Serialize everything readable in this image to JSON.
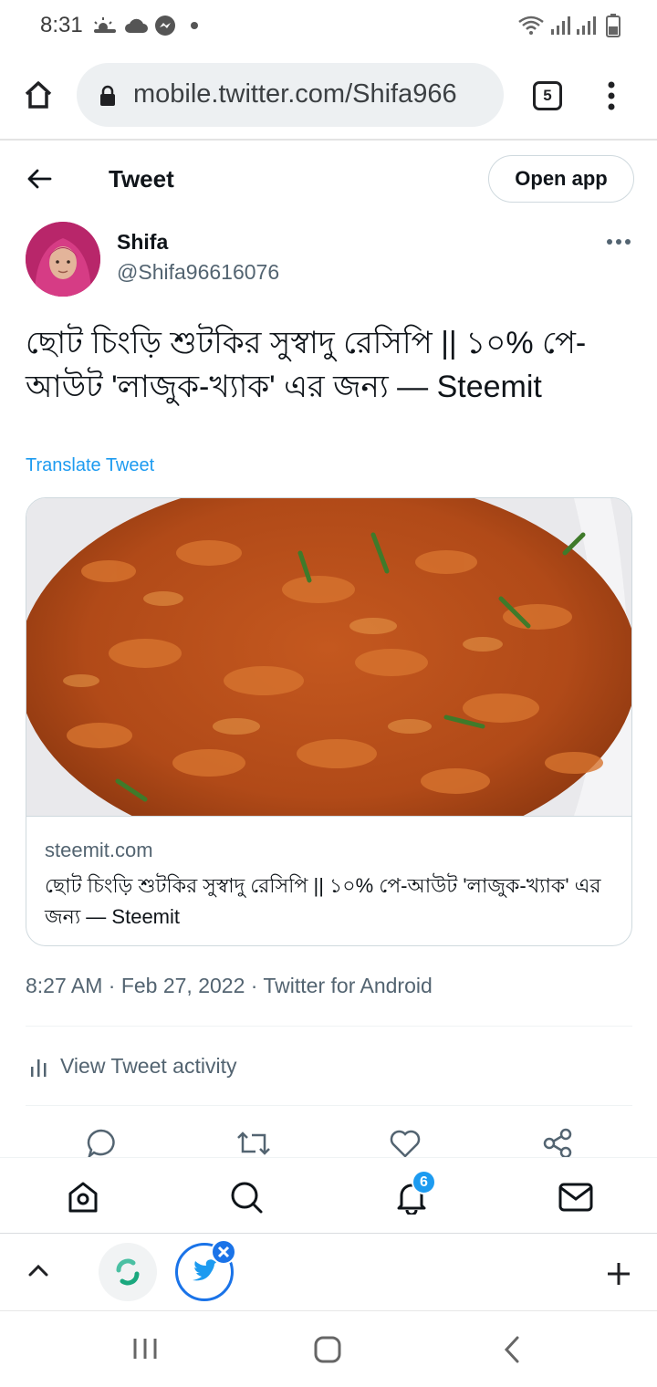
{
  "status_bar": {
    "time": "8:31",
    "left_icons": [
      "sun-cloud-icon",
      "cloud-icon",
      "messenger-icon",
      "dot-icon"
    ],
    "right_icons": [
      "wifi-icon",
      "signal-icon",
      "signal-icon",
      "battery-icon"
    ]
  },
  "browser": {
    "url": "mobile.twitter.com/Shifa966",
    "tab_count": "5"
  },
  "header": {
    "title": "Tweet",
    "open_app_label": "Open app"
  },
  "tweet": {
    "author_name": "Shifa",
    "author_handle": "@Shifa96616076",
    "text": "ছোট চিংড়ি শুটকির সুস্বাদু রেসিপি || ১০% পে-আউট 'লাজুক-খ্যাক' এর জন্য — Steemit",
    "translate_label": "Translate Tweet",
    "card": {
      "domain": "steemit.com",
      "title": "ছোট চিংড়ি শুটকির সুস্বাদু রেসিপি || ১০% পে-আউট 'লাজুক-খ্যাক' এর জন্য — Steemit"
    },
    "meta": "8:27 AM · Feb 27, 2022 · Twitter for Android",
    "activity_label": "View Tweet activity"
  },
  "twitter_nav": {
    "notification_count": "6"
  },
  "colors": {
    "twitter_blue": "#1d9bf0",
    "secondary_text": "#536471",
    "chrome_blue": "#1a73e8"
  }
}
